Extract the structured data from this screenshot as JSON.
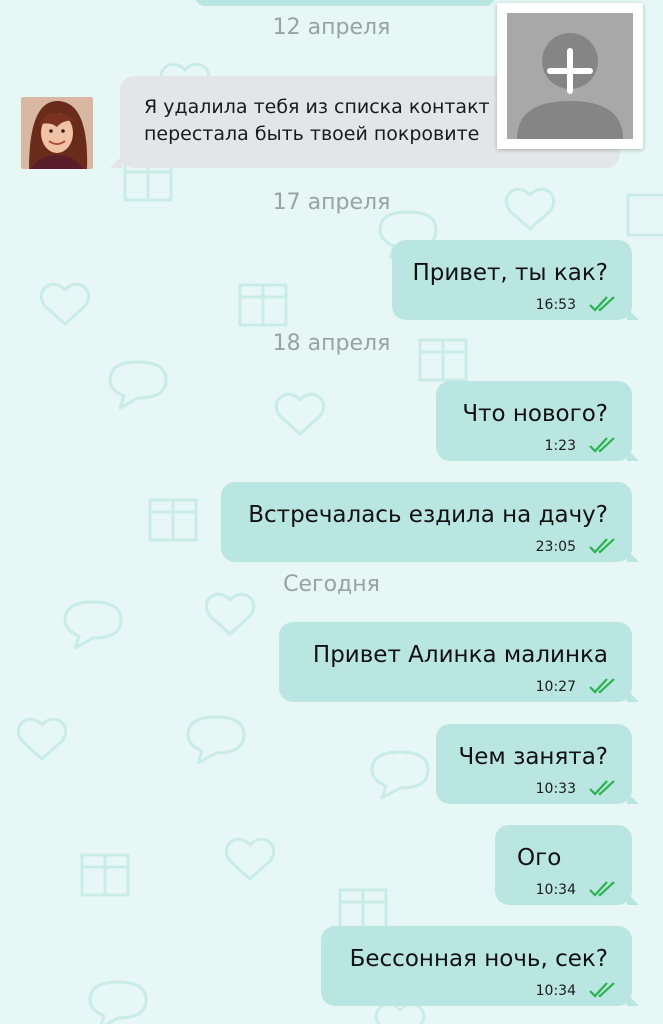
{
  "dates": {
    "d1": "12 апреля",
    "d2": "17 апреля",
    "d3": "18 апреля",
    "d4": "Сегодня"
  },
  "incoming": {
    "line1": "Я удалила тебя из списка контакт",
    "line2": "перестала быть твоей покровите"
  },
  "messages": [
    {
      "text": "Привет, ты как?",
      "time": "16:53"
    },
    {
      "text": "Что нового?",
      "time": "1:23"
    },
    {
      "text": "Встречалась ездила на дачу?",
      "time": "23:05"
    },
    {
      "text": "Привет Алинка малинка",
      "time": "10:27"
    },
    {
      "text": "Чем занята?",
      "time": "10:33"
    },
    {
      "text": "Ого",
      "time": "10:34"
    },
    {
      "text": "Бессонная ночь, сек?",
      "time": "10:34"
    }
  ],
  "colors": {
    "background": "#e6f7f5",
    "outgoing_bubble": "#b9e6e1",
    "incoming_bubble": "#e3e6e6",
    "read_ticks": "#2bb24c",
    "date_text": "#9aa3a3"
  },
  "icons": {
    "add_contact": "add-contact-icon",
    "read_receipt": "double-check-icon"
  }
}
